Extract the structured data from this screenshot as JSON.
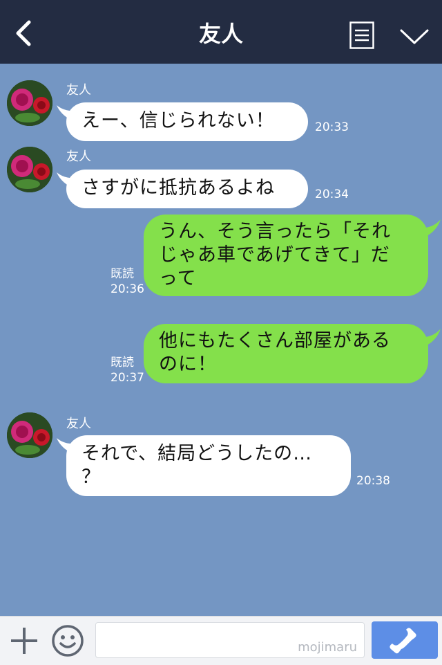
{
  "header": {
    "title": "友人"
  },
  "messages": [
    {
      "sender": "友人",
      "text": "えー、信じられない！",
      "time": "20:33"
    },
    {
      "sender": "友人",
      "text": "さすがに抵抗あるよね",
      "time": "20:34"
    },
    {
      "line1": "うん、そう言ったら「それ",
      "line2": "じゃあ車であげてきて」だ",
      "line3": "って",
      "read": "既読",
      "time": "20:36"
    },
    {
      "line1": "他にもたくさん部屋がある",
      "line2": "のに！",
      "read": "既読",
      "time": "20:37"
    },
    {
      "sender": "友人",
      "line1": "それで、結局どうしたの…",
      "line2": "？",
      "time": "20:38"
    }
  ],
  "footer": {
    "watermark": "mojimaru"
  },
  "colors": {
    "header": "#232c42",
    "background": "#7496c3",
    "outgoing": "#84e04b",
    "call": "#5d8ee6"
  },
  "icons": [
    "back-chevron-icon",
    "menu-icon",
    "chevron-down-icon",
    "plus-icon",
    "emoji-icon",
    "phone-icon"
  ]
}
